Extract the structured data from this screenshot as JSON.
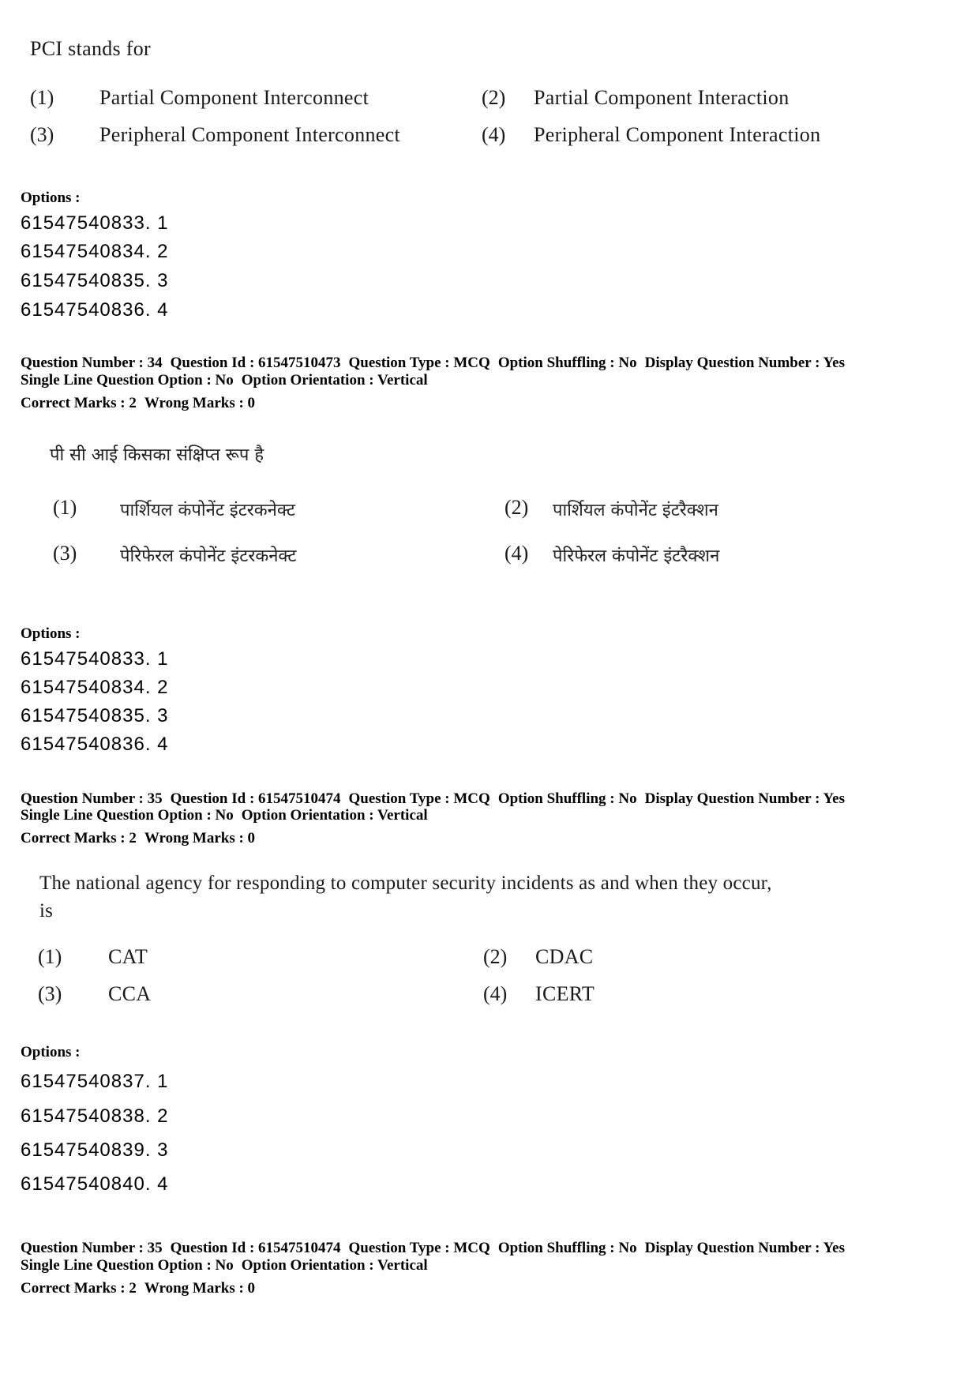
{
  "q33": {
    "question": "PCI stands for",
    "choices": [
      {
        "num": "(1)",
        "text": "Partial Component Interconnect"
      },
      {
        "num": "(2)",
        "text": "Partial Component Interaction"
      },
      {
        "num": "(3)",
        "text": "Peripheral Component Interconnect"
      },
      {
        "num": "(4)",
        "text": "Peripheral Component Interaction"
      }
    ],
    "options_label": "Options :",
    "option_ids": [
      "61547540833. 1",
      "61547540834. 2",
      "61547540835. 3",
      "61547540836. 4"
    ]
  },
  "q34": {
    "meta": {
      "question_number": "Question Number : 34",
      "question_id": "Question Id : 61547510473",
      "question_type": "Question Type : MCQ",
      "option_shuffling": "Option Shuffling : No",
      "display_question_number": "Display Question Number : Yes",
      "single_line": "Single Line Question Option : No",
      "orientation": "Option Orientation : Vertical",
      "correct_marks": "Correct Marks : 2",
      "wrong_marks": "Wrong Marks : 0"
    },
    "question": "पी सी आई किसका संक्षिप्त रूप है",
    "choices": [
      {
        "num": "(1)",
        "text": "पार्शियल कंपोनेंट इंटरकनेक्ट"
      },
      {
        "num": "(2)",
        "text": "पार्शियल कंपोनेंट इंटरैक्शन"
      },
      {
        "num": "(3)",
        "text": "पेरिफेरल कंपोनेंट इंटरकनेक्ट"
      },
      {
        "num": "(4)",
        "text": "पेरिफेरल कंपोनेंट इंटरैक्शन"
      }
    ],
    "options_label": "Options :",
    "option_ids": [
      "61547540833. 1",
      "61547540834. 2",
      "61547540835. 3",
      "61547540836. 4"
    ]
  },
  "q35": {
    "meta": {
      "question_number": "Question Number : 35",
      "question_id": "Question Id : 61547510474",
      "question_type": "Question Type : MCQ",
      "option_shuffling": "Option Shuffling : No",
      "display_question_number": "Display Question Number : Yes",
      "single_line": "Single Line Question Option : No",
      "orientation": "Option Orientation : Vertical",
      "correct_marks": "Correct Marks : 2",
      "wrong_marks": "Wrong Marks : 0"
    },
    "question_line1": "The national agency for responding to computer security incidents as and when they occur,",
    "question_line2": "is",
    "choices": [
      {
        "num": "(1)",
        "text": "CAT"
      },
      {
        "num": "(2)",
        "text": "CDAC"
      },
      {
        "num": "(3)",
        "text": "CCA"
      },
      {
        "num": "(4)",
        "text": "ICERT"
      }
    ],
    "options_label": "Options :",
    "option_ids": [
      "61547540837. 1",
      "61547540838. 2",
      "61547540839. 3",
      "61547540840. 4"
    ]
  },
  "q35b": {
    "meta": {
      "question_number": "Question Number : 35",
      "question_id": "Question Id : 61547510474",
      "question_type": "Question Type : MCQ",
      "option_shuffling": "Option Shuffling : No",
      "display_question_number": "Display Question Number : Yes",
      "single_line": "Single Line Question Option : No",
      "orientation": "Option Orientation : Vertical",
      "correct_marks": "Correct Marks : 2",
      "wrong_marks": "Wrong Marks : 0"
    }
  }
}
